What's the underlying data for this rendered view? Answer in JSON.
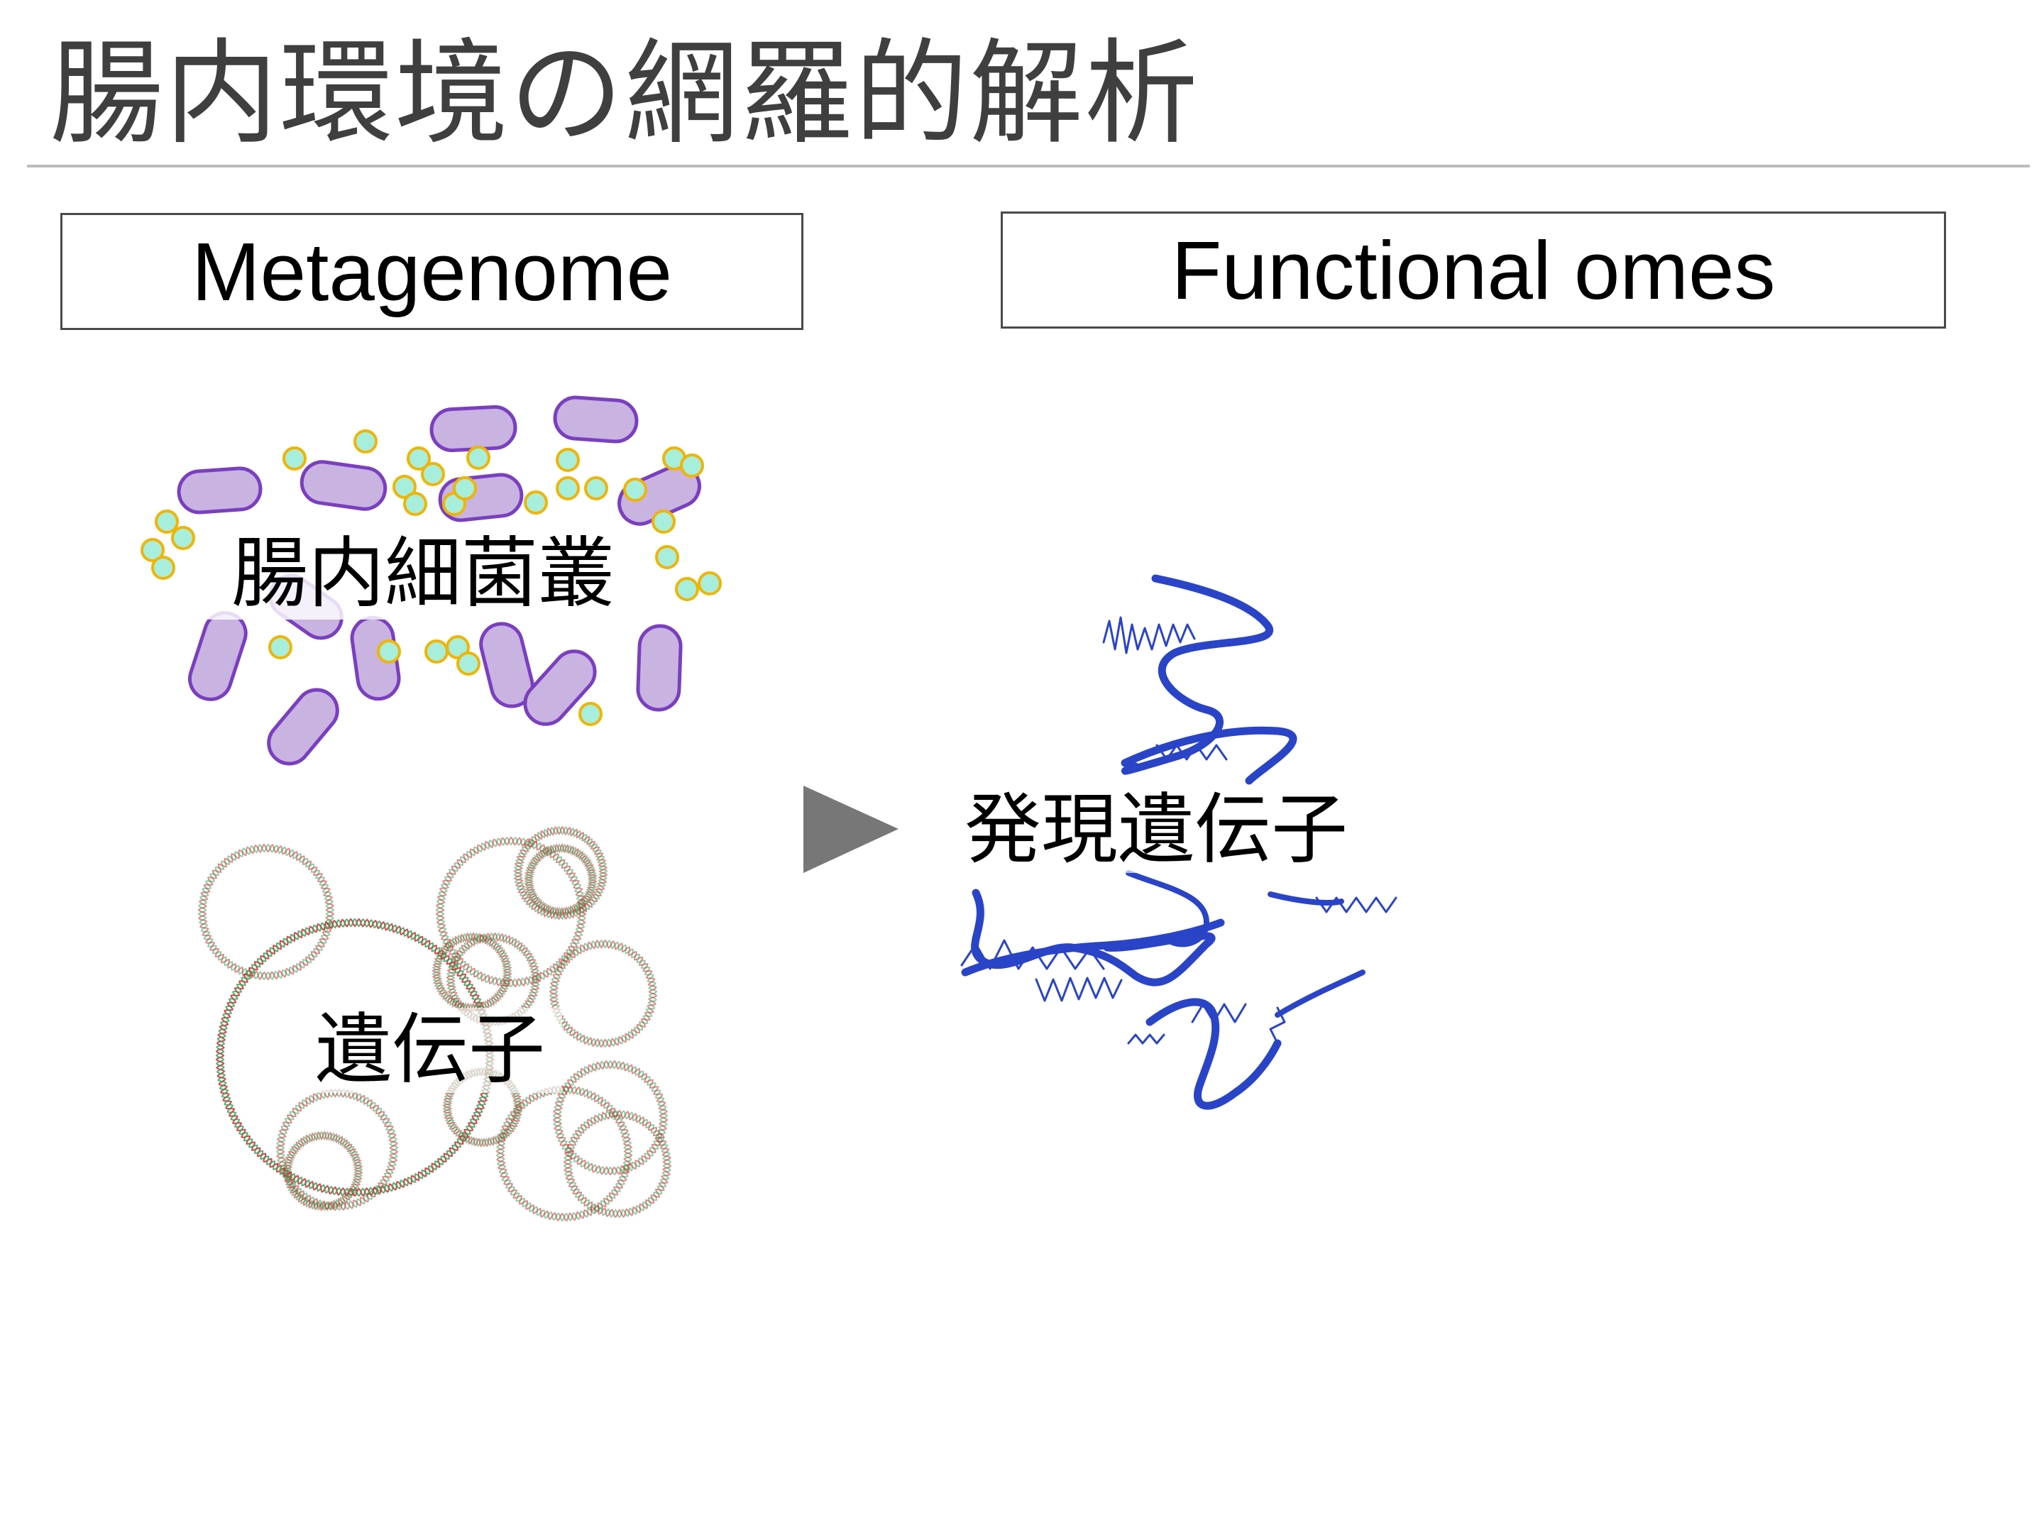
{
  "slide": {
    "title": "腸内環境の網羅的解析"
  },
  "headers": {
    "left": "Metagenome",
    "right": "Functional omes"
  },
  "labels": {
    "bacteria": "腸内細菌叢",
    "genes": "遺伝子",
    "expressed_genes": "発現遺伝子"
  },
  "colors": {
    "title_text": "#3f3f3f",
    "rule": "#bdbdbd",
    "bacteria_fill": "#c9b3e0",
    "bacteria_stroke": "#7a3fc0",
    "cell_fill": "#a8eedd",
    "cell_stroke": "#f0b400",
    "dna_red": "#d22222",
    "dna_green": "#38a060",
    "arrow": "#777777",
    "expressed_blue": "#2a44c8"
  },
  "icons": {
    "arrow": "right-triangle-arrow"
  }
}
